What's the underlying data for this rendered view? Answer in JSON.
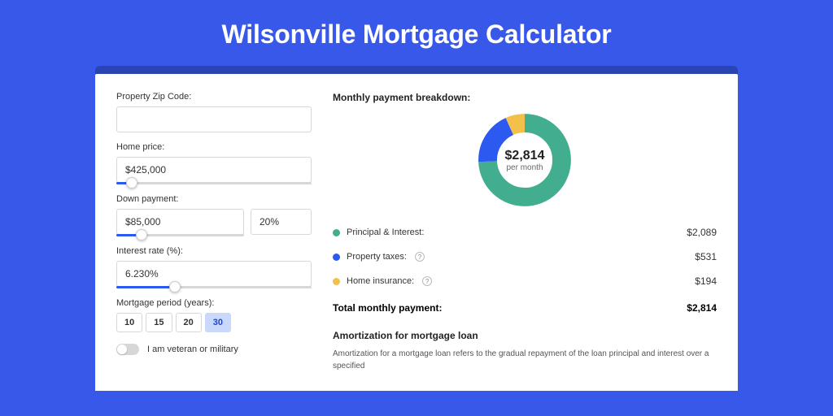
{
  "page_title": "Wilsonville Mortgage Calculator",
  "form": {
    "zip_label": "Property Zip Code:",
    "zip_value": "",
    "home_price_label": "Home price:",
    "home_price_value": "$425,000",
    "home_price_slider_pct": 8,
    "down_payment_label": "Down payment:",
    "down_payment_value": "$85,000",
    "down_payment_pct_value": "20%",
    "down_payment_slider_pct": 20,
    "interest_label": "Interest rate (%):",
    "interest_value": "6.230%",
    "interest_slider_pct": 30,
    "period_label": "Mortgage period (years):",
    "periods": [
      "10",
      "15",
      "20",
      "30"
    ],
    "period_active_index": 3,
    "veteran_label": "I am veteran or military",
    "veteran_on": false
  },
  "breakdown": {
    "title": "Monthly payment breakdown:",
    "center_value": "$2,814",
    "center_sub": "per month",
    "items": [
      {
        "label": "Principal & Interest:",
        "value": "$2,089",
        "color": "pi",
        "help": false
      },
      {
        "label": "Property taxes:",
        "value": "$531",
        "color": "tax",
        "help": true
      },
      {
        "label": "Home insurance:",
        "value": "$194",
        "color": "ins",
        "help": true
      }
    ],
    "total_label": "Total monthly payment:",
    "total_value": "$2,814"
  },
  "amortization": {
    "title": "Amortization for mortgage loan",
    "text": "Amortization for a mortgage loan refers to the gradual repayment of the loan principal and interest over a specified"
  },
  "chart_data": {
    "type": "pie",
    "title": "Monthly payment breakdown",
    "series": [
      {
        "name": "Principal & Interest",
        "value": 2089,
        "color": "#42ad8f"
      },
      {
        "name": "Property taxes",
        "value": 531,
        "color": "#2c5af0"
      },
      {
        "name": "Home insurance",
        "value": 194,
        "color": "#f3c14b"
      }
    ],
    "total": 2814,
    "unit": "USD per month"
  }
}
